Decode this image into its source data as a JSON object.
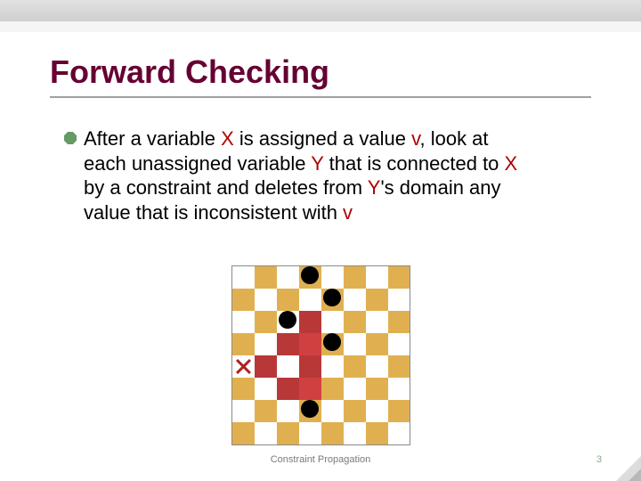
{
  "slide": {
    "title": "Forward Checking",
    "body_parts": {
      "p0": "After a variable ",
      "x": "X",
      "p1": " is assigned a value ",
      "v1": "v",
      "p2": ", look at each unassigned variable ",
      "y1": "Y",
      "p3": " that is connected to ",
      "x2": "X",
      "p4": " by a constraint and deletes from ",
      "y2": "Y",
      "p5": "'s domain any value that is inconsistent with ",
      "v2": "v"
    },
    "footer": "Constraint Propagation",
    "page_number": "3"
  },
  "chart_data": {
    "type": "table",
    "title": "8-queens forward-checking board state",
    "rows": 8,
    "cols": 8,
    "legend": {
      "W": "white square (checker light)",
      "B": "tan square (checker dark)",
      "P": "pink/eliminated square",
      "Q": "square with a placed queen (black dot)",
      "X": "marked square with red cross (candidate)"
    },
    "grid": [
      [
        "W",
        "B",
        "W",
        "Q",
        "W",
        "B",
        "W",
        "B"
      ],
      [
        "B",
        "W",
        "B",
        "W",
        "Q",
        "W",
        "B",
        "W"
      ],
      [
        "W",
        "B",
        "Q",
        "P",
        "W",
        "B",
        "W",
        "B"
      ],
      [
        "B",
        "W",
        "P",
        "P",
        "Q",
        "W",
        "B",
        "W"
      ],
      [
        "X",
        "P",
        "W",
        "P",
        "W",
        "B",
        "W",
        "B"
      ],
      [
        "B",
        "W",
        "P",
        "P",
        "B",
        "W",
        "B",
        "W"
      ],
      [
        "W",
        "B",
        "W",
        "Q",
        "W",
        "B",
        "W",
        "B"
      ],
      [
        "B",
        "W",
        "B",
        "W",
        "B",
        "W",
        "B",
        "W"
      ]
    ]
  }
}
